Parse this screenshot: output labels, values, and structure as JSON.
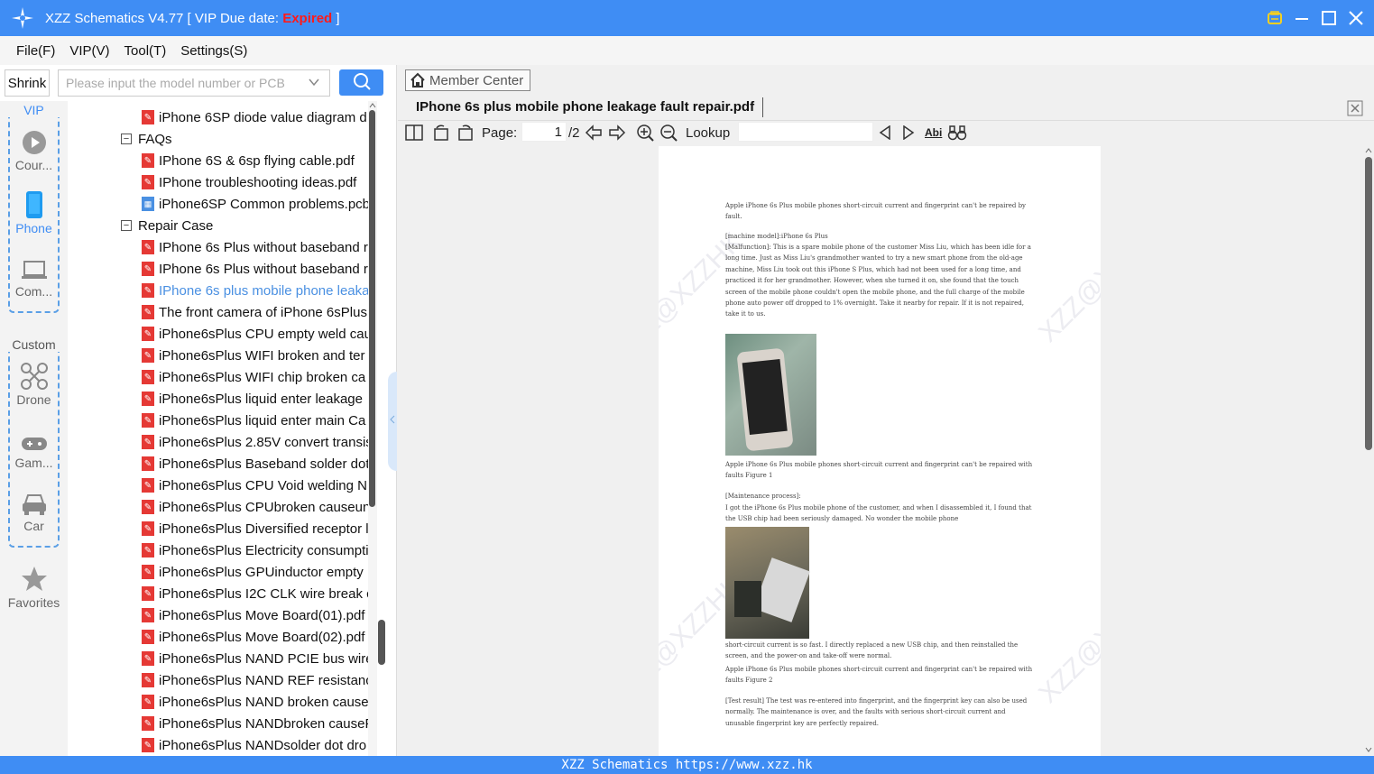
{
  "titlebar": {
    "title": "XZZ Schematics V4.77 [ VIP Due date: ",
    "status": "Expired",
    "close_bracket": " ]"
  },
  "menu": [
    "File(F)",
    "VIP(V)",
    "Tool(T)",
    "Settings(S)"
  ],
  "shrink_label": "Shrink",
  "search": {
    "placeholder": "Please input the model number or PCB"
  },
  "categories": {
    "vip_label": "VIP",
    "custom_label": "Custom",
    "items": [
      "Cour...",
      "Phone",
      "Com...",
      "Drone",
      "Gam...",
      "Car",
      "Favorites"
    ]
  },
  "tree": [
    {
      "type": "pdf",
      "label": "iPhone 6SP diode value diagram d"
    },
    {
      "type": "folder",
      "label": "FAQs"
    },
    {
      "type": "pdf",
      "label": "IPhone 6S & 6sp flying cable.pdf"
    },
    {
      "type": "pdf",
      "label": "IPhone troubleshooting ideas.pdf"
    },
    {
      "type": "pcb",
      "label": "iPhone6SP Common problems.pcb"
    },
    {
      "type": "folder",
      "label": "Repair Case"
    },
    {
      "type": "pdf",
      "label": "IPhone 6s Plus without baseband r"
    },
    {
      "type": "pdf",
      "label": "IPhone 6s Plus without baseband r"
    },
    {
      "type": "pdf",
      "label": "IPhone 6s plus mobile phone leaka",
      "selected": true
    },
    {
      "type": "pdf",
      "label": "The front camera of iPhone 6sPlus"
    },
    {
      "type": "pdf",
      "label": "iPhone6sPlus  CPU empty weld cau"
    },
    {
      "type": "pdf",
      "label": "iPhone6sPlus  WIFI broken and ter"
    },
    {
      "type": "pdf",
      "label": "iPhone6sPlus  WIFI chip broken ca"
    },
    {
      "type": "pdf",
      "label": "iPhone6sPlus  liquid enter leakage"
    },
    {
      "type": "pdf",
      "label": "iPhone6sPlus  liquid enter main Ca"
    },
    {
      "type": "pdf",
      "label": "iPhone6sPlus 2.85V convert transis"
    },
    {
      "type": "pdf",
      "label": "iPhone6sPlus Baseband solder dot"
    },
    {
      "type": "pdf",
      "label": "iPhone6sPlus CPU Void welding N"
    },
    {
      "type": "pdf",
      "label": "iPhone6sPlus CPUbroken causeun"
    },
    {
      "type": "pdf",
      "label": "iPhone6sPlus Diversified receptor l"
    },
    {
      "type": "pdf",
      "label": "iPhone6sPlus Electricity consumpti"
    },
    {
      "type": "pdf",
      "label": "iPhone6sPlus GPUinductor empty"
    },
    {
      "type": "pdf",
      "label": "iPhone6sPlus I2C CLK wire break  c"
    },
    {
      "type": "pdf",
      "label": "iPhone6sPlus Move Board(01).pdf"
    },
    {
      "type": "pdf",
      "label": "iPhone6sPlus Move Board(02).pdf"
    },
    {
      "type": "pdf",
      "label": "iPhone6sPlus NAND PCIE bus wire"
    },
    {
      "type": "pdf",
      "label": "iPhone6sPlus NAND REF resistanc"
    },
    {
      "type": "pdf",
      "label": "iPhone6sPlus NAND broken cause"
    },
    {
      "type": "pdf",
      "label": "iPhone6sPlus NANDbroken causeP"
    },
    {
      "type": "pdf",
      "label": "iPhone6sPlus NANDsolder dot dro"
    }
  ],
  "member_center": "Member Center",
  "tab_title": "IPhone 6s plus mobile phone leakage fault repair.pdf",
  "toolbar": {
    "page_label": "Page:",
    "page_value": "1",
    "page_total": "/2",
    "lookup_label": "Lookup",
    "abi": "Abi"
  },
  "doc": {
    "p1": "Apple iPhone 6s Plus mobile phones short-circuit current and fingerprint can't be repaired by fault.",
    "p2": "[machine model]:iPhone 6s Plus",
    "p3": "[Malfunction]: This is a spare mobile phone of the customer Miss Liu, which has been idle for a long time. Just as Miss Liu's grandmother wanted to try a new smart phone from the old-age machine, Miss Liu took out this iPhone S Plus, which had not been used for a long time, and practiced it for her grandmother. However, when she turned it on, she found that the touch screen of the mobile phone couldn't open the mobile phone, and the full charge of the mobile phone auto power off dropped to 1% overnight. Take it nearby for repair. If it is not repaired, take it to us.",
    "cap1": "Apple iPhone 6s Plus mobile phones short-circuit current and fingerprint can't be repaired with faults Figure 1",
    "p4": "[Maintenance process]:",
    "p5": "I got the iPhone 6s Plus mobile phone of the customer, and when I disassembled it, I found that the USB chip had been seriously damaged. No wonder the mobile phone",
    "p6": "short-circuit current is so fast. I directly replaced a new USB chip, and then reinstalled the screen, and the power-on and take-off were normal.",
    "cap2": "Apple iPhone 6s Plus mobile phones short-circuit current and fingerprint can't be repaired with faults Figure 2",
    "p7": "[Test result] The test was re-entered into fingerprint, and the fingerprint key can also be used normally. The maintenance is over, and the faults with serious short-circuit current and unusable fingerprint key are perfectly repaired.",
    "watermark": "XZZ@XZZHK"
  },
  "footer": "XZZ Schematics https://www.xzz.hk"
}
